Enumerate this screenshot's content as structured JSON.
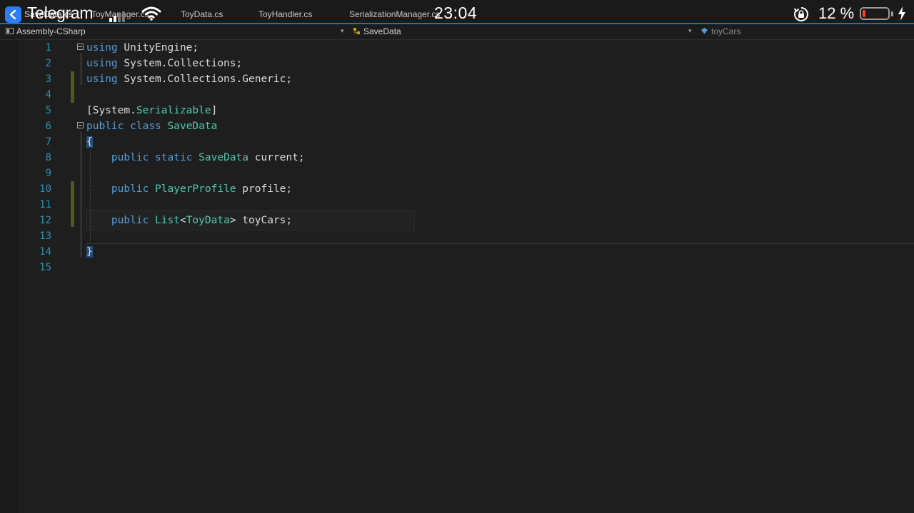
{
  "editor_tabs": [
    {
      "label": "SaveData.cs",
      "active": true
    },
    {
      "label": "ToyManager.cs",
      "active": false
    },
    {
      "label": "ToyData.cs",
      "active": false
    },
    {
      "label": "ToyHandler.cs",
      "active": false
    },
    {
      "label": "SerializationManager.cs",
      "active": false
    }
  ],
  "status_bar": {
    "app_name": "Telegram",
    "time": "23:04",
    "battery_percent": "12 %",
    "battery_level": 0.12,
    "battery_color": "#ff3b30"
  },
  "navbar": {
    "project": "Assembly-CSharp",
    "class": "SaveData",
    "member": "toyCars"
  },
  "code": {
    "line_numbers": [
      "1",
      "2",
      "3",
      "4",
      "5",
      "6",
      "7",
      "8",
      "9",
      "10",
      "11",
      "12",
      "13",
      "14",
      "15"
    ],
    "lines": [
      [
        {
          "t": "using",
          "c": "kw"
        },
        {
          "t": " UnityEngine;",
          "c": "pl"
        }
      ],
      [
        {
          "t": "using",
          "c": "kw"
        },
        {
          "t": " System.Collections;",
          "c": "pl"
        }
      ],
      [
        {
          "t": "using",
          "c": "kw"
        },
        {
          "t": " System.Collections.Generic;",
          "c": "pl"
        }
      ],
      [],
      [
        {
          "t": "[System.",
          "c": "pl"
        },
        {
          "t": "Serializable",
          "c": "ty"
        },
        {
          "t": "]",
          "c": "pl"
        }
      ],
      [
        {
          "t": "public",
          "c": "kw"
        },
        {
          "t": " ",
          "c": "pl"
        },
        {
          "t": "class",
          "c": "kw"
        },
        {
          "t": " ",
          "c": "pl"
        },
        {
          "t": "SaveData",
          "c": "ty"
        }
      ],
      [
        {
          "t": "{",
          "c": "pl"
        }
      ],
      [
        {
          "t": "    ",
          "c": "pl"
        },
        {
          "t": "public",
          "c": "kw"
        },
        {
          "t": " ",
          "c": "pl"
        },
        {
          "t": "static",
          "c": "kw"
        },
        {
          "t": " ",
          "c": "pl"
        },
        {
          "t": "SaveData",
          "c": "ty"
        },
        {
          "t": " current;",
          "c": "pl"
        }
      ],
      [],
      [
        {
          "t": "    ",
          "c": "pl"
        },
        {
          "t": "public",
          "c": "kw"
        },
        {
          "t": " ",
          "c": "pl"
        },
        {
          "t": "PlayerProfile",
          "c": "ty"
        },
        {
          "t": " profile;",
          "c": "pl"
        }
      ],
      [],
      [
        {
          "t": "    ",
          "c": "pl"
        },
        {
          "t": "public",
          "c": "kw"
        },
        {
          "t": " ",
          "c": "pl"
        },
        {
          "t": "List",
          "c": "ty"
        },
        {
          "t": "<",
          "c": "pl"
        },
        {
          "t": "ToyData",
          "c": "ty"
        },
        {
          "t": "> toyCars;",
          "c": "pl"
        }
      ],
      [],
      [
        {
          "t": "}",
          "c": "pl"
        }
      ],
      []
    ]
  }
}
